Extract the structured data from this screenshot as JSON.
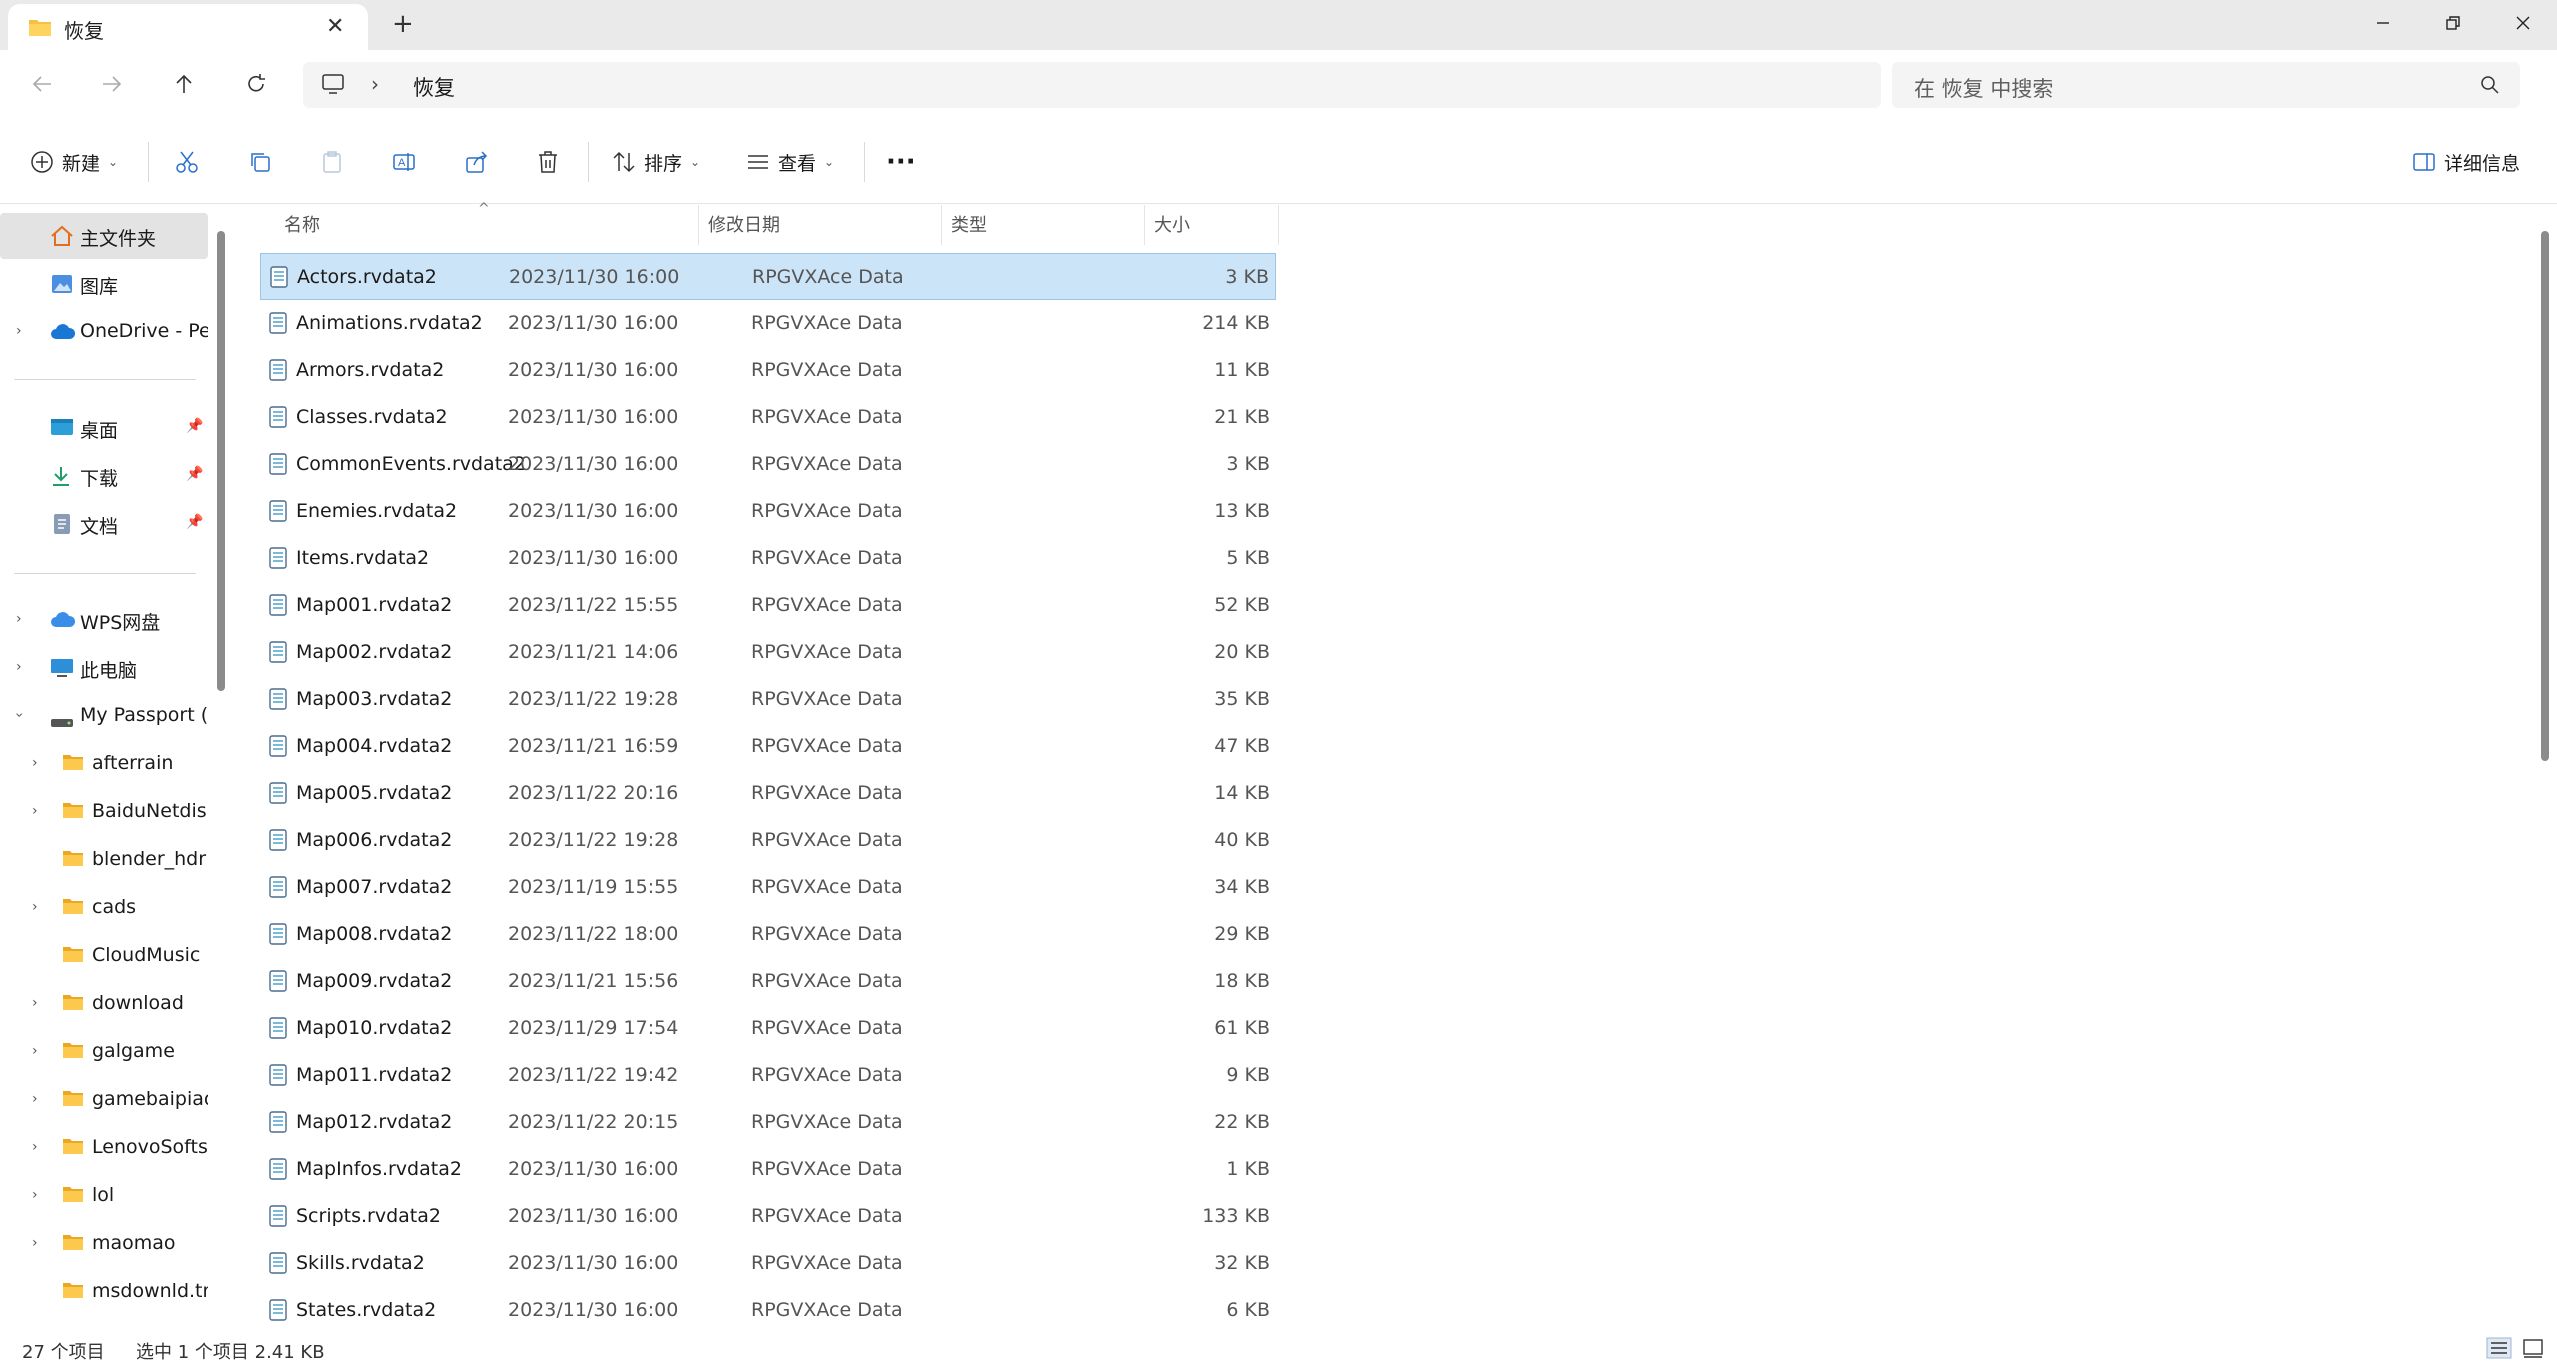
{
  "window": {
    "tab_title": "恢复",
    "new_tab": "+"
  },
  "address": {
    "crumb": "恢复",
    "search_placeholder": "在 恢复 中搜索"
  },
  "toolbar": {
    "new_label": "新建",
    "sort_label": "排序",
    "view_label": "查看",
    "more_label": "···",
    "details_label": "详细信息"
  },
  "sidebar": {
    "home": "主文件夹",
    "gallery": "图库",
    "onedrive": "OneDrive - Per",
    "desktop": "桌面",
    "downloads": "下载",
    "documents": "文档",
    "wps": "WPS网盘",
    "thispc": "此电脑",
    "passport": "My Passport (E",
    "folders": [
      "afterrain",
      "BaiduNetdisk",
      "blender_hdr",
      "cads",
      "CloudMusic",
      "download",
      "galgame",
      "gamebaipiao",
      "LenovoSoftsto",
      "lol",
      "maomao",
      "msdownld.tm"
    ]
  },
  "columns": {
    "name": "名称",
    "date": "修改日期",
    "type": "类型",
    "size": "大小"
  },
  "files": [
    {
      "name": "Actors.rvdata2",
      "date": "2023/11/30 16:00",
      "type": "RPGVXAce Data",
      "size": "3 KB"
    },
    {
      "name": "Animations.rvdata2",
      "date": "2023/11/30 16:00",
      "type": "RPGVXAce Data",
      "size": "214 KB"
    },
    {
      "name": "Armors.rvdata2",
      "date": "2023/11/30 16:00",
      "type": "RPGVXAce Data",
      "size": "11 KB"
    },
    {
      "name": "Classes.rvdata2",
      "date": "2023/11/30 16:00",
      "type": "RPGVXAce Data",
      "size": "21 KB"
    },
    {
      "name": "CommonEvents.rvdata2",
      "date": "2023/11/30 16:00",
      "type": "RPGVXAce Data",
      "size": "3 KB"
    },
    {
      "name": "Enemies.rvdata2",
      "date": "2023/11/30 16:00",
      "type": "RPGVXAce Data",
      "size": "13 KB"
    },
    {
      "name": "Items.rvdata2",
      "date": "2023/11/30 16:00",
      "type": "RPGVXAce Data",
      "size": "5 KB"
    },
    {
      "name": "Map001.rvdata2",
      "date": "2023/11/22 15:55",
      "type": "RPGVXAce Data",
      "size": "52 KB"
    },
    {
      "name": "Map002.rvdata2",
      "date": "2023/11/21 14:06",
      "type": "RPGVXAce Data",
      "size": "20 KB"
    },
    {
      "name": "Map003.rvdata2",
      "date": "2023/11/22 19:28",
      "type": "RPGVXAce Data",
      "size": "35 KB"
    },
    {
      "name": "Map004.rvdata2",
      "date": "2023/11/21 16:59",
      "type": "RPGVXAce Data",
      "size": "47 KB"
    },
    {
      "name": "Map005.rvdata2",
      "date": "2023/11/22 20:16",
      "type": "RPGVXAce Data",
      "size": "14 KB"
    },
    {
      "name": "Map006.rvdata2",
      "date": "2023/11/22 19:28",
      "type": "RPGVXAce Data",
      "size": "40 KB"
    },
    {
      "name": "Map007.rvdata2",
      "date": "2023/11/19 15:55",
      "type": "RPGVXAce Data",
      "size": "34 KB"
    },
    {
      "name": "Map008.rvdata2",
      "date": "2023/11/22 18:00",
      "type": "RPGVXAce Data",
      "size": "29 KB"
    },
    {
      "name": "Map009.rvdata2",
      "date": "2023/11/21 15:56",
      "type": "RPGVXAce Data",
      "size": "18 KB"
    },
    {
      "name": "Map010.rvdata2",
      "date": "2023/11/29 17:54",
      "type": "RPGVXAce Data",
      "size": "61 KB"
    },
    {
      "name": "Map011.rvdata2",
      "date": "2023/11/22 19:42",
      "type": "RPGVXAce Data",
      "size": "9 KB"
    },
    {
      "name": "Map012.rvdata2",
      "date": "2023/11/22 20:15",
      "type": "RPGVXAce Data",
      "size": "22 KB"
    },
    {
      "name": "MapInfos.rvdata2",
      "date": "2023/11/30 16:00",
      "type": "RPGVXAce Data",
      "size": "1 KB"
    },
    {
      "name": "Scripts.rvdata2",
      "date": "2023/11/30 16:00",
      "type": "RPGVXAce Data",
      "size": "133 KB"
    },
    {
      "name": "Skills.rvdata2",
      "date": "2023/11/30 16:00",
      "type": "RPGVXAce Data",
      "size": "32 KB"
    },
    {
      "name": "States.rvdata2",
      "date": "2023/11/30 16:00",
      "type": "RPGVXAce Data",
      "size": "6 KB"
    }
  ],
  "status": {
    "count": "27 个项目",
    "selected": "选中 1 个项目  2.41 KB"
  },
  "colors": {
    "selection": "#cce4f7",
    "selection_border": "#9dc4e6",
    "folder": "#f5c044",
    "accent": "#0067c0"
  }
}
